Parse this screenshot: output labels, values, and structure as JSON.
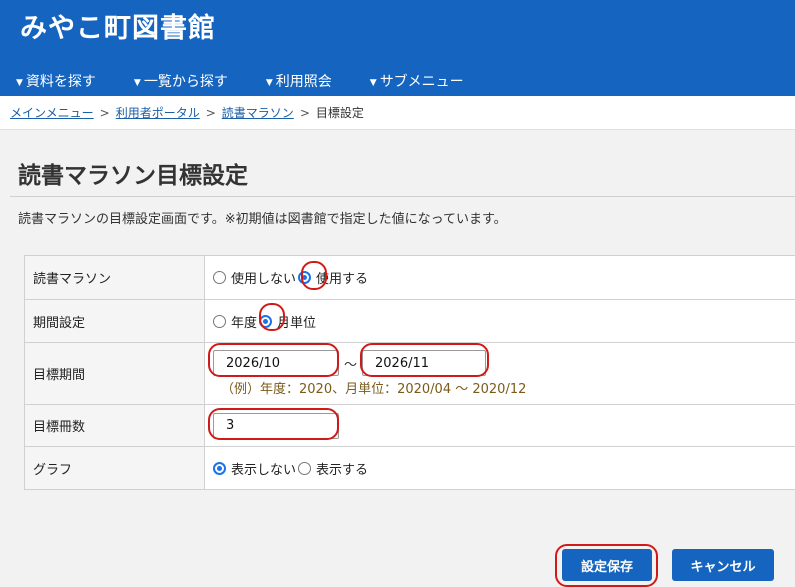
{
  "header": {
    "site_title": "みやこ町図書館",
    "nav": [
      "資料を探す",
      "一覧から探す",
      "利用照会",
      "サブメニュー"
    ]
  },
  "breadcrumb": {
    "items": [
      "メインメニュー",
      "利用者ポータル",
      "読書マラソン"
    ],
    "current": "目標設定",
    "separator": ">"
  },
  "page": {
    "title": "読書マラソン目標設定",
    "description": "読書マラソンの目標設定画面です。※初期値は図書館で指定した値になっています。"
  },
  "form": {
    "marathon": {
      "label": "読書マラソン",
      "options": [
        "使用しない",
        "使用する"
      ],
      "selected": "使用する"
    },
    "period_type": {
      "label": "期間設定",
      "options": [
        "年度",
        "月単位"
      ],
      "selected": "月単位"
    },
    "target_period": {
      "label": "目標期間",
      "from": "2026/10",
      "to": "2026/11",
      "separator": "～",
      "example": "（例）年度：2020、月単位：2020/04 ～ 2020/12"
    },
    "target_count": {
      "label": "目標冊数",
      "value": "3"
    },
    "graph": {
      "label": "グラフ",
      "options": [
        "表示しない",
        "表示する"
      ],
      "selected": "表示しない"
    }
  },
  "buttons": {
    "save": "設定保存",
    "cancel": "キャンセル"
  },
  "colors": {
    "brand": "#1565c0",
    "highlight": "#d01a1a",
    "radio_checked": "#1a73e8"
  }
}
